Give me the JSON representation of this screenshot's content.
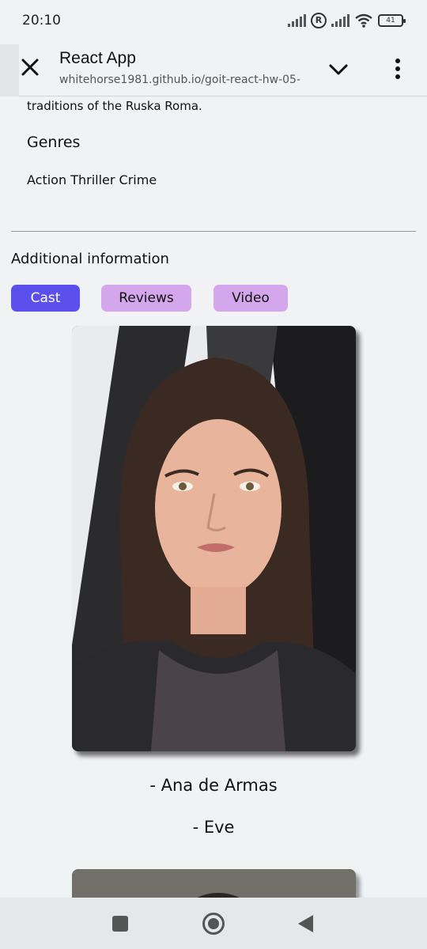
{
  "status_bar": {
    "time": "20:10",
    "battery": "41"
  },
  "browser": {
    "title": "React App",
    "url": "whitehorse1981.github.io/goit-react-hw-05-"
  },
  "movie": {
    "overview_tail": "traditions of the Ruska Roma.",
    "genres_heading": "Genres",
    "genres": "Action Thriller Crime"
  },
  "additional": {
    "heading": "Additional information",
    "tabs": [
      {
        "label": "Cast",
        "active": true
      },
      {
        "label": "Reviews",
        "active": false
      },
      {
        "label": "Video",
        "active": false
      }
    ]
  },
  "cast": [
    {
      "name": "- Ana de Armas",
      "character": "- Eve",
      "photo_icon": "actor-portrait"
    }
  ],
  "colors": {
    "active_tab": "#5b50ee",
    "inactive_tab": "#d4a6ec",
    "background": "#f1f2f4"
  }
}
